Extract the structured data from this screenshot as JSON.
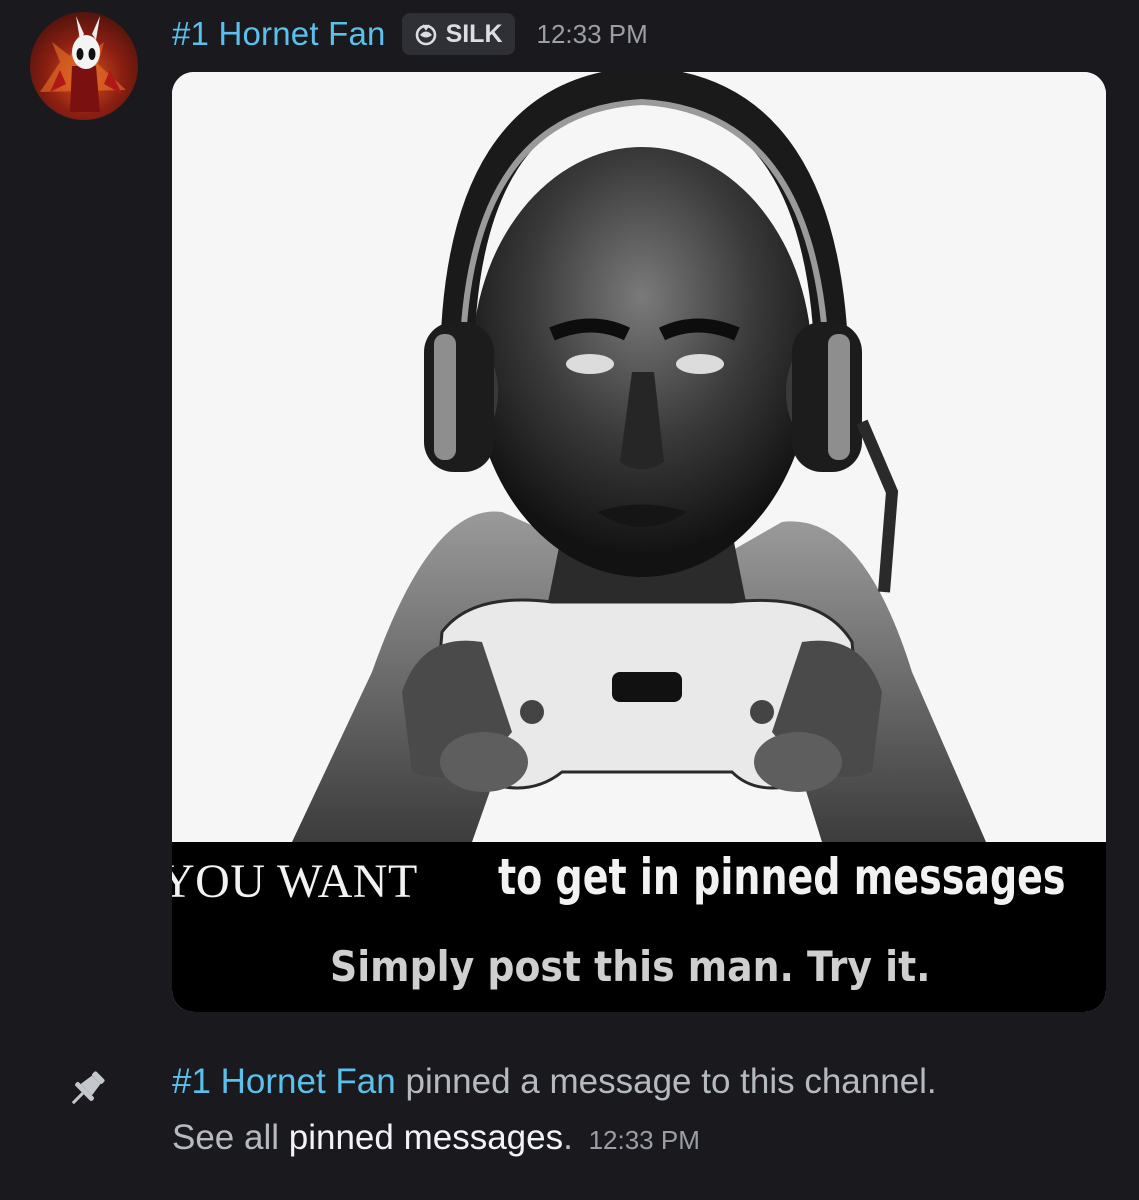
{
  "message": {
    "author": "#1 Hornet Fan",
    "tag_label": "SILK",
    "tag_icon": "silk-guild-icon",
    "timestamp": "12:33 PM",
    "avatar_icon": "hornet-avatar-icon",
    "attachment": {
      "caption_left": "YOU WANT",
      "caption_right": "to get in pinned messages",
      "caption_bottom": "Simply post this man. Try it."
    }
  },
  "system_message": {
    "icon": "pin-icon",
    "author": "#1 Hornet Fan",
    "action_text": " pinned a message to this channel.",
    "prefix": "See all ",
    "link_text": "pinned messages",
    "suffix": ".",
    "timestamp": "12:33 PM"
  },
  "colors": {
    "background": "#1a1a1e",
    "username": "#5bc0eb",
    "muted": "#9b9ea6",
    "tag_bg": "#2f2f36"
  }
}
